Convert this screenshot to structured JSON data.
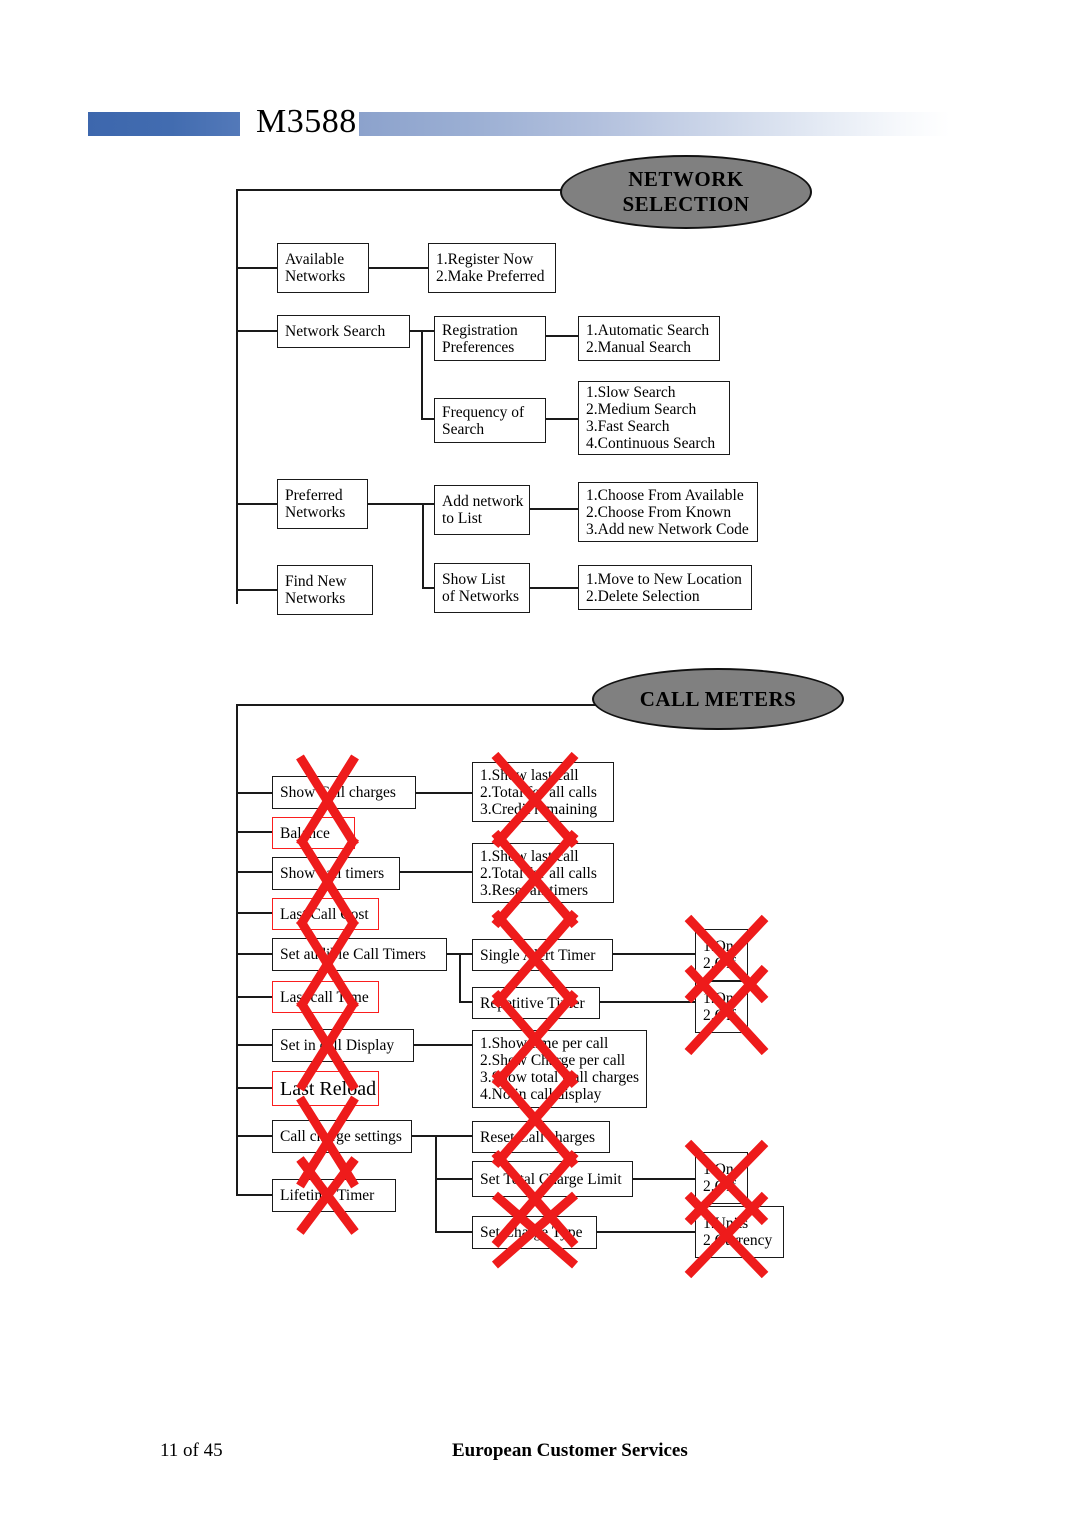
{
  "header": {
    "title": "M3588",
    "accent_color": "#3d67ad",
    "gradient_from": "#8ca2cc",
    "gradient_to": "#ffffff"
  },
  "footer": {
    "page_label": "11   of 45",
    "organization": "European Customer Services"
  },
  "annotation": {
    "strike_color": "#ee1b1b",
    "highlight_border_color": "#fa1e1e"
  },
  "sections": [
    {
      "id": "network-selection",
      "heading": "NETWORK SELECTION",
      "heading_lines": [
        "NETWORK",
        "SELECTION"
      ],
      "ellipse_fill": "#808080"
    },
    {
      "id": "call-meters",
      "heading": "CALL METERS",
      "heading_lines": [
        "CALL METERS"
      ],
      "ellipse_fill": "#808080"
    }
  ],
  "network_selection": {
    "level1": [
      {
        "id": "available-networks",
        "lines": [
          "Available",
          "Networks"
        ]
      },
      {
        "id": "network-search",
        "lines": [
          "Network Search"
        ]
      },
      {
        "id": "preferred-networks",
        "lines": [
          "Preferred",
          "Networks"
        ]
      },
      {
        "id": "find-new-networks",
        "lines": [
          "Find New",
          "Networks"
        ]
      }
    ],
    "level2": [
      {
        "id": "register-options",
        "lines": [
          "1.Register Now",
          "2.Make Preferred"
        ]
      },
      {
        "id": "registration-preferences",
        "lines": [
          "Registration",
          "Preferences"
        ]
      },
      {
        "id": "frequency-of-search",
        "lines": [
          "Frequency of",
          "Search"
        ]
      },
      {
        "id": "add-network-to-list",
        "lines": [
          "Add network",
          "to List"
        ]
      },
      {
        "id": "show-list-of-networks",
        "lines": [
          "Show List",
          "of Networks"
        ]
      }
    ],
    "level3": [
      {
        "id": "search-mode-options",
        "lines": [
          "1.Automatic Search",
          "2.Manual Search"
        ]
      },
      {
        "id": "search-speed-options",
        "lines": [
          "1.Slow Search",
          "2.Medium Search",
          "3.Fast Search",
          "4.Continuous Search"
        ]
      },
      {
        "id": "add-network-options",
        "lines": [
          "1.Choose From Available",
          "2.Choose From Known",
          "3.Add new Network Code"
        ]
      },
      {
        "id": "list-actions-options",
        "lines": [
          "1.Move to New Location",
          "2.Delete Selection"
        ]
      }
    ]
  },
  "call_meters": {
    "level1": [
      {
        "id": "show-call-charges",
        "lines": [
          "Show Call charges"
        ],
        "style": "black",
        "struck": true
      },
      {
        "id": "balance",
        "lines": [
          "Balance"
        ],
        "style": "red",
        "struck": false
      },
      {
        "id": "show-call-timers",
        "lines": [
          "Show call timers"
        ],
        "style": "black",
        "struck": true
      },
      {
        "id": "last-call-cost",
        "lines": [
          "Last Call Cost"
        ],
        "style": "red",
        "struck": false
      },
      {
        "id": "set-audible-call-timers",
        "lines": [
          "Set audible Call Timers"
        ],
        "style": "black",
        "struck": true
      },
      {
        "id": "last-call-time",
        "lines": [
          "Last call Time"
        ],
        "style": "red",
        "struck": false
      },
      {
        "id": "set-in-call-display",
        "lines": [
          "Set in call Display"
        ],
        "style": "black",
        "struck": true
      },
      {
        "id": "last-reload",
        "lines": [
          "Last Reload"
        ],
        "style": "red",
        "struck": false
      },
      {
        "id": "call-charge-settings",
        "lines": [
          "Call charge settings"
        ],
        "style": "black",
        "struck": true
      },
      {
        "id": "lifetime-timer",
        "lines": [
          "Lifetime Timer"
        ],
        "style": "black",
        "struck": true
      }
    ],
    "level2": [
      {
        "id": "call-charges-options",
        "lines": [
          "1.Show last call",
          "2.Total for all calls",
          "3.Credit remaining"
        ],
        "struck": true
      },
      {
        "id": "call-timers-options",
        "lines": [
          "1.Show last call",
          "2.Total for all calls",
          "3.Reset all timers"
        ],
        "struck": true
      },
      {
        "id": "single-alert-timer",
        "lines": [
          "Single Alert Timer"
        ],
        "struck": true
      },
      {
        "id": "repetitive-timer",
        "lines": [
          "Repetitive Timer"
        ],
        "struck": true
      },
      {
        "id": "in-call-display-options",
        "lines": [
          "1.Show time per call",
          "2.Show Charge per call",
          "3.Show total Call charges",
          "4.No in call display"
        ],
        "struck": true
      },
      {
        "id": "reset-call-charges",
        "lines": [
          "Reset Call charges"
        ],
        "struck": true
      },
      {
        "id": "set-total-charge-limit",
        "lines": [
          "Set Total Charge Limit"
        ],
        "struck": true
      },
      {
        "id": "set-charge-type",
        "lines": [
          "Set Charge Type"
        ],
        "struck": true
      }
    ],
    "level3": [
      {
        "id": "single-alert-onoff",
        "lines": [
          "1.On",
          "2.Off"
        ],
        "struck": true
      },
      {
        "id": "repetitive-onoff",
        "lines": [
          "1.On",
          "2.Off"
        ],
        "struck": true
      },
      {
        "id": "charge-limit-onoff",
        "lines": [
          "1.On",
          "2.Off"
        ],
        "struck": true
      },
      {
        "id": "charge-type-options",
        "lines": [
          "1.Units",
          "2.Currency"
        ],
        "struck": true
      }
    ]
  }
}
